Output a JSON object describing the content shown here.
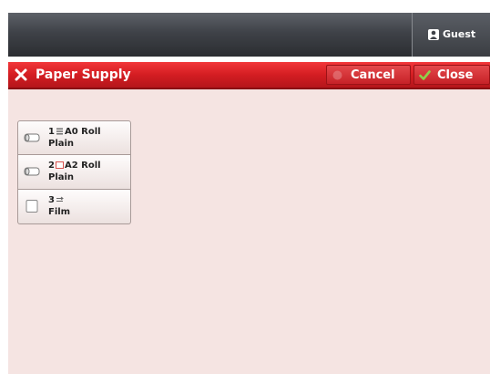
{
  "header": {
    "user_label": "Guest",
    "user_icon": "person-icon"
  },
  "dialog": {
    "title": "Paper Supply",
    "close_icon": "close-x-icon",
    "cancel_label": "Cancel",
    "cancel_icon": "cancel-icon",
    "close_label": "Close",
    "close_icon_check": "checkmark-icon"
  },
  "trays": [
    {
      "number": "1",
      "size": "A0 Roll",
      "type": "Plain",
      "paper_icon": "roll-paper-icon",
      "size_icon": "roll-feed-icon"
    },
    {
      "number": "2",
      "size": "A2 Roll",
      "type": "Plain",
      "paper_icon": "roll-paper-icon",
      "size_icon": "cut-sheet-icon"
    },
    {
      "number": "3",
      "size": "",
      "type": "Film",
      "paper_icon": "sheet-paper-icon",
      "size_icon": "bypass-feed-icon"
    }
  ],
  "colors": {
    "title_bar": "#d41d22",
    "dialog_bg": "#f5e4e2",
    "top_bar": "#3f4248",
    "check_green": "#7ec23a"
  }
}
